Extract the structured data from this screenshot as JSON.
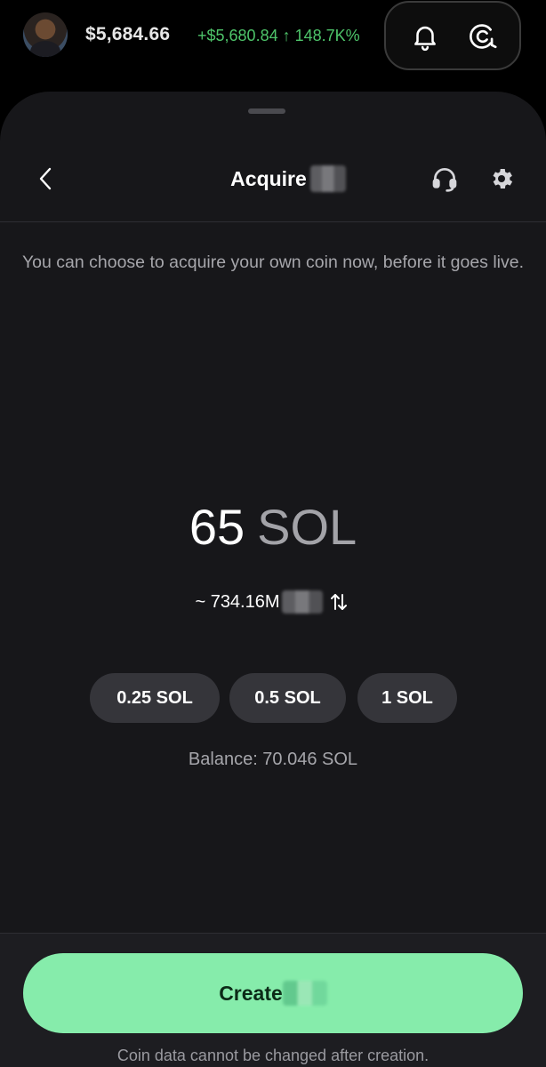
{
  "header": {
    "balance": "$5,684.66",
    "change": "+$5,680.84 ↑ 148.7K%",
    "accent_color": "#4ec46a"
  },
  "sheet": {
    "title": "Acquire",
    "description": "You can choose to acquire your own coin now, before it goes live."
  },
  "amount": {
    "value": "65",
    "unit": "SOL",
    "conversion": "~ 734.16M"
  },
  "presets": [
    {
      "label": "0.25 SOL"
    },
    {
      "label": "0.5 SOL"
    },
    {
      "label": "1 SOL"
    }
  ],
  "balance_text": "Balance: 70.046 SOL",
  "footer": {
    "create_label": "Create",
    "note": "Coin data cannot be changed after creation.",
    "button_color": "#86ecab"
  },
  "icons": {
    "bell": "bell-icon",
    "chat": "chat-icon",
    "back": "chevron-left-icon",
    "support": "headset-icon",
    "settings": "gear-icon",
    "swap": "swap-vertical-icon"
  }
}
